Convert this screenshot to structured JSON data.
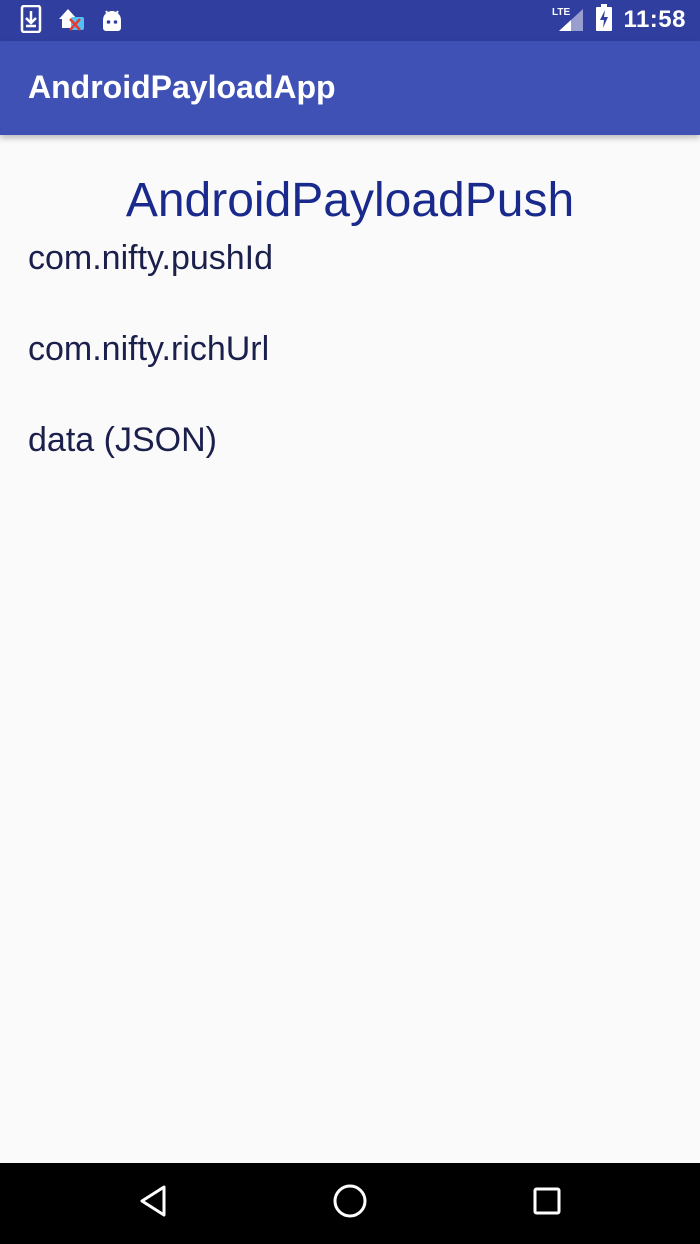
{
  "status_bar": {
    "time": "11:58",
    "network": "LTE",
    "icons": [
      "download-icon",
      "notification-icon",
      "android-icon",
      "lte-signal-icon",
      "battery-charging-icon"
    ]
  },
  "app_bar": {
    "title": "AndroidPayloadApp",
    "color": "#3f51b5"
  },
  "main": {
    "heading": "AndroidPayloadPush",
    "fields": [
      {
        "label": "com.nifty.pushId"
      },
      {
        "label": "com.nifty.richUrl"
      },
      {
        "label": "data (JSON)"
      }
    ]
  },
  "nav_bar": {
    "buttons": [
      "back-icon",
      "home-icon",
      "recents-icon"
    ]
  }
}
